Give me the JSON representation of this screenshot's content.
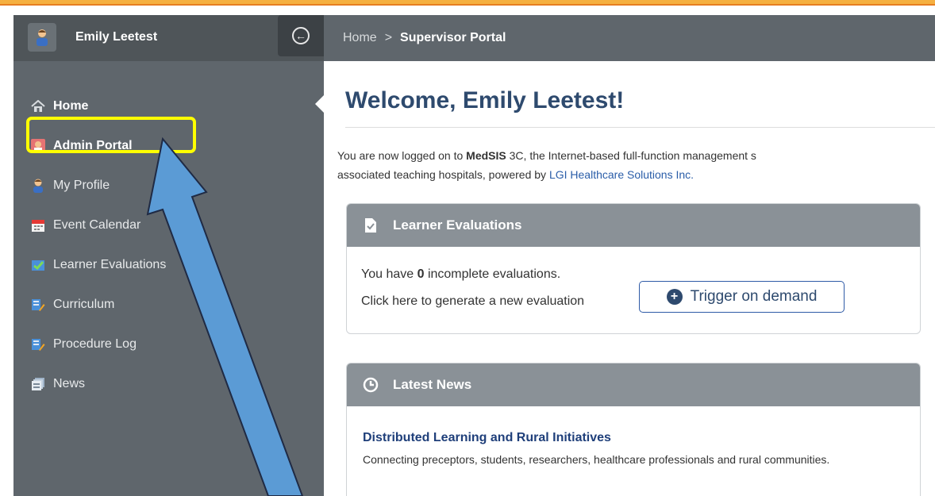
{
  "user": {
    "name": "Emily Leetest"
  },
  "breadcrumb": {
    "home": "Home",
    "separator": ">",
    "current": "Supervisor Portal"
  },
  "sidebar": {
    "items": [
      {
        "label": "Home",
        "icon": "home-icon"
      },
      {
        "label": "Admin Portal",
        "icon": "admin-portal-icon"
      },
      {
        "label": "My Profile",
        "icon": "profile-icon"
      },
      {
        "label": "Event Calendar",
        "icon": "calendar-icon"
      },
      {
        "label": "Learner Evaluations",
        "icon": "evaluation-icon"
      },
      {
        "label": "Curriculum",
        "icon": "curriculum-icon"
      },
      {
        "label": "Procedure Log",
        "icon": "procedure-log-icon"
      },
      {
        "label": "News",
        "icon": "news-icon"
      }
    ]
  },
  "main": {
    "title": "Welcome, Emily Leetest!",
    "intro_before": "You are now logged on to ",
    "intro_brand": "MedSIS",
    "intro_mid": " 3C, the Internet-based full-function management s",
    "intro_line2": "associated teaching hospitals, powered by ",
    "intro_link": "LGI Healthcare Solutions Inc.",
    "learner_evaluations": {
      "heading": "Learner Evaluations",
      "line1_before": "You have ",
      "count": "0",
      "line1_after": " incomplete evaluations.",
      "line2": "Click here to generate a new evaluation",
      "trigger_label": "Trigger on demand"
    },
    "latest_news": {
      "heading": "Latest News",
      "item_title": "Distributed Learning and Rural Initiatives",
      "item_desc": "Connecting preceptors, students, researchers, healthcare professionals and rural communities."
    }
  },
  "colors": {
    "sidebar_bg": "#5f666c",
    "header_bg": "#5f666c",
    "panel_head_bg": "#8a9197",
    "title_color": "#2e4a6e",
    "highlight": "#ffff00",
    "arrow_fill": "#5b9bd5"
  }
}
